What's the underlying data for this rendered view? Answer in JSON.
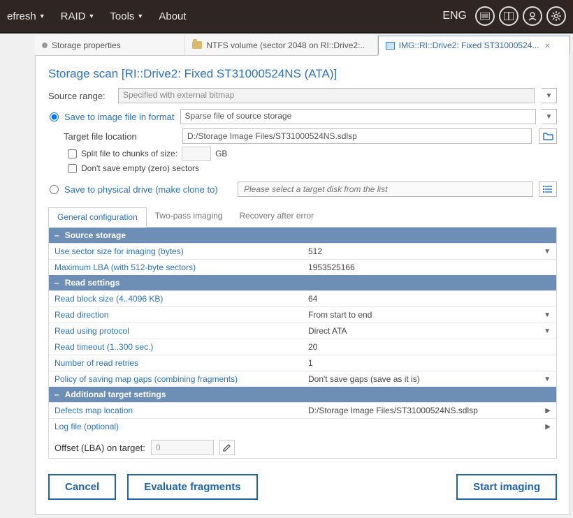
{
  "menu": {
    "refresh": "efresh",
    "raid": "RAID",
    "tools": "Tools",
    "about": "About",
    "lang": "ENG"
  },
  "tabs": {
    "props": "Storage properties",
    "ntfs": "NTFS volume (sector 2048 on RI::Drive2:..",
    "img": "IMG::RI::Drive2: Fixed ST31000524..."
  },
  "title": "Storage scan [RI::Drive2: Fixed ST31000524NS (ATA)]",
  "source_range_label": "Source range:",
  "source_range_value": "Specified with external bitmap",
  "save_image": {
    "radio_label": "Save to image file in format",
    "format_value": "Sparse file of source storage",
    "target_label": "Target file location",
    "target_value": "D:/Storage Image Files/ST31000524NS.sdlsp",
    "split_label": "Split file to chunks of size:",
    "split_unit": "GB",
    "zero_label": "Don't save empty (zero) sectors"
  },
  "save_phys": {
    "radio_label": "Save to physical drive (make clone to)",
    "placeholder": "Please select a target disk from the list"
  },
  "inner_tabs": {
    "general": "General configuration",
    "twopass": "Two-pass imaging",
    "recovery": "Recovery after error"
  },
  "sections": {
    "source": {
      "title": "Source storage",
      "rows": [
        {
          "label": "Use sector size for imaging (bytes)",
          "value": "512",
          "drop": true
        },
        {
          "label": "Maximum LBA (with 512-byte sectors)",
          "value": "1953525166",
          "drop": false
        }
      ]
    },
    "read": {
      "title": "Read settings",
      "rows": [
        {
          "label": "Read block size (4..4096 KB)",
          "value": "64",
          "drop": false
        },
        {
          "label": "Read direction",
          "value": "From start to end",
          "drop": true
        },
        {
          "label": "Read using protocol",
          "value": "Direct ATA",
          "drop": true
        },
        {
          "label": "Read timeout (1..300 sec.)",
          "value": "20",
          "drop": false
        },
        {
          "label": "Number of read retries",
          "value": "1",
          "drop": false
        },
        {
          "label": "Policy of saving map gaps (combining fragments)",
          "value": "Don't save gaps (save as it is)",
          "drop": true
        }
      ]
    },
    "target": {
      "title": "Additional target settings",
      "rows": [
        {
          "label": "Defects map location",
          "value": "D:/Storage Image Files/ST31000524NS.sdlsp",
          "arrow": true
        },
        {
          "label": "Log file (optional)",
          "value": "",
          "arrow": true
        }
      ]
    }
  },
  "offset": {
    "label": "Offset (LBA) on target:",
    "value": "0"
  },
  "buttons": {
    "cancel": "Cancel",
    "evaluate": "Evaluate fragments",
    "start": "Start imaging"
  }
}
